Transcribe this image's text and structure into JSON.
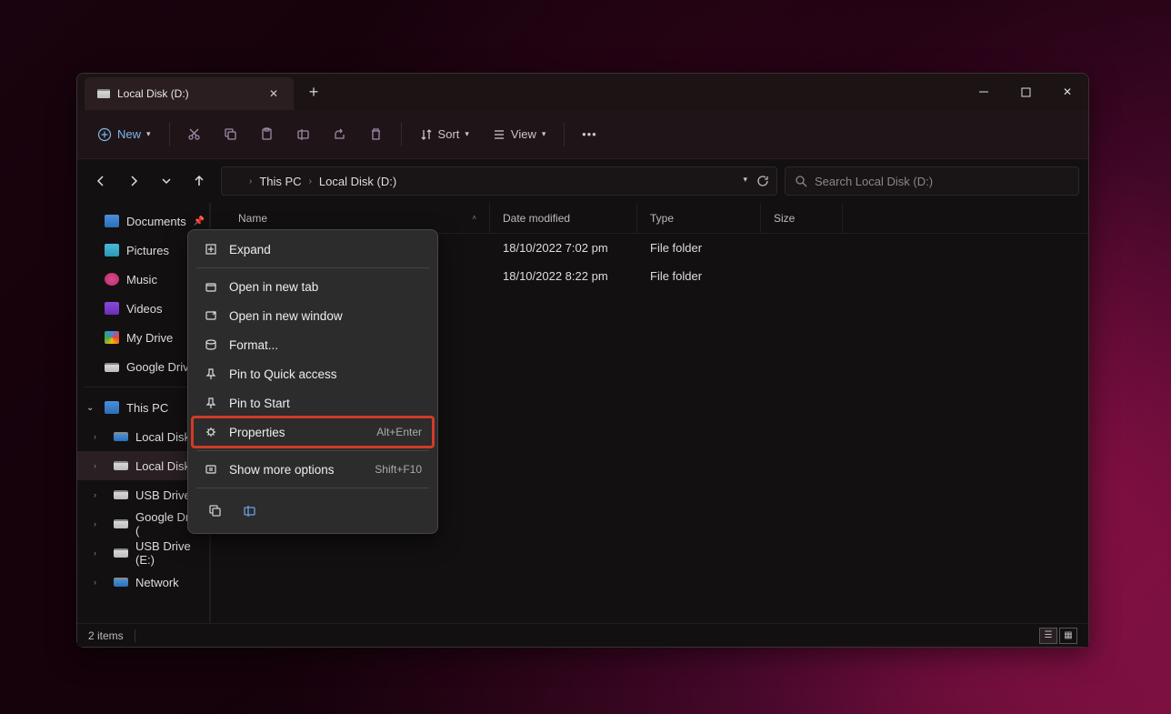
{
  "tab": {
    "title": "Local Disk (D:)"
  },
  "toolbar": {
    "new_label": "New",
    "sort_label": "Sort",
    "view_label": "View"
  },
  "breadcrumb": {
    "root": "This PC",
    "current": "Local Disk (D:)"
  },
  "search": {
    "placeholder": "Search Local Disk (D:)"
  },
  "sidebar": {
    "quick": [
      {
        "label": "Documents",
        "pinned": true
      },
      {
        "label": "Pictures",
        "pinned": true
      },
      {
        "label": "Music"
      },
      {
        "label": "Videos"
      },
      {
        "label": "My Drive"
      },
      {
        "label": "Google Drive"
      }
    ],
    "thispc_label": "This PC",
    "drives": [
      {
        "label": "Local Disk (C"
      },
      {
        "label": "Local Disk (D"
      },
      {
        "label": "USB Drive (E"
      },
      {
        "label": "Google Drive ("
      },
      {
        "label": "USB Drive (E:)"
      },
      {
        "label": "Network"
      }
    ],
    "selected_index": 1
  },
  "columns": {
    "name": "Name",
    "date": "Date modified",
    "type": "Type",
    "size": "Size"
  },
  "rows": [
    {
      "date": "18/10/2022 7:02 pm",
      "type": "File folder"
    },
    {
      "date": "18/10/2022 8:22 pm",
      "type": "File folder"
    }
  ],
  "status": {
    "items": "2 items"
  },
  "context_menu": {
    "items": [
      {
        "label": "Expand",
        "icon": "expand-icon"
      },
      {
        "div": true
      },
      {
        "label": "Open in new tab",
        "icon": "new-tab-icon"
      },
      {
        "label": "Open in new window",
        "icon": "new-window-icon"
      },
      {
        "label": "Format...",
        "icon": "format-icon"
      },
      {
        "label": "Pin to Quick access",
        "icon": "pin-icon"
      },
      {
        "label": "Pin to Start",
        "icon": "pin-icon"
      },
      {
        "label": "Properties",
        "icon": "properties-icon",
        "shortcut": "Alt+Enter",
        "highlighted": true
      },
      {
        "div": true
      },
      {
        "label": "Show more options",
        "icon": "more-icon",
        "shortcut": "Shift+F10"
      }
    ]
  }
}
